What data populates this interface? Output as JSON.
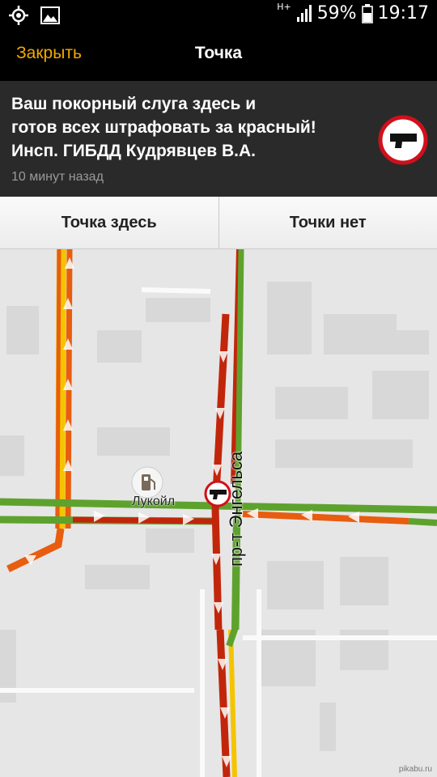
{
  "status_bar": {
    "network": "H+",
    "battery": "59%",
    "time": "19:17",
    "icons": [
      "gps-icon",
      "image-icon",
      "signal-icon",
      "battery-icon"
    ]
  },
  "action_bar": {
    "close_label": "Закрыть",
    "title": "Точка"
  },
  "message": {
    "text": "Ваш покорный слуга здесь и\nготов всех штрафовать за красный!\nИнсп. ГИБДД Кудрявцев В.А.",
    "time_ago": "10 минут назад",
    "icon": "police-gun-icon"
  },
  "buttons": {
    "here": "Точка здесь",
    "not_here": "Точки нет"
  },
  "map": {
    "poi_label": "Лукойл",
    "poi_icon": "fuel-station-icon",
    "street_label": "пр-т Энгельса",
    "watermark": "pikabu.ru",
    "colors": {
      "jam_red": "#c2260a",
      "slow_orange": "#e85d0f",
      "free_green": "#5ea22e",
      "yellow": "#f5c400"
    }
  }
}
